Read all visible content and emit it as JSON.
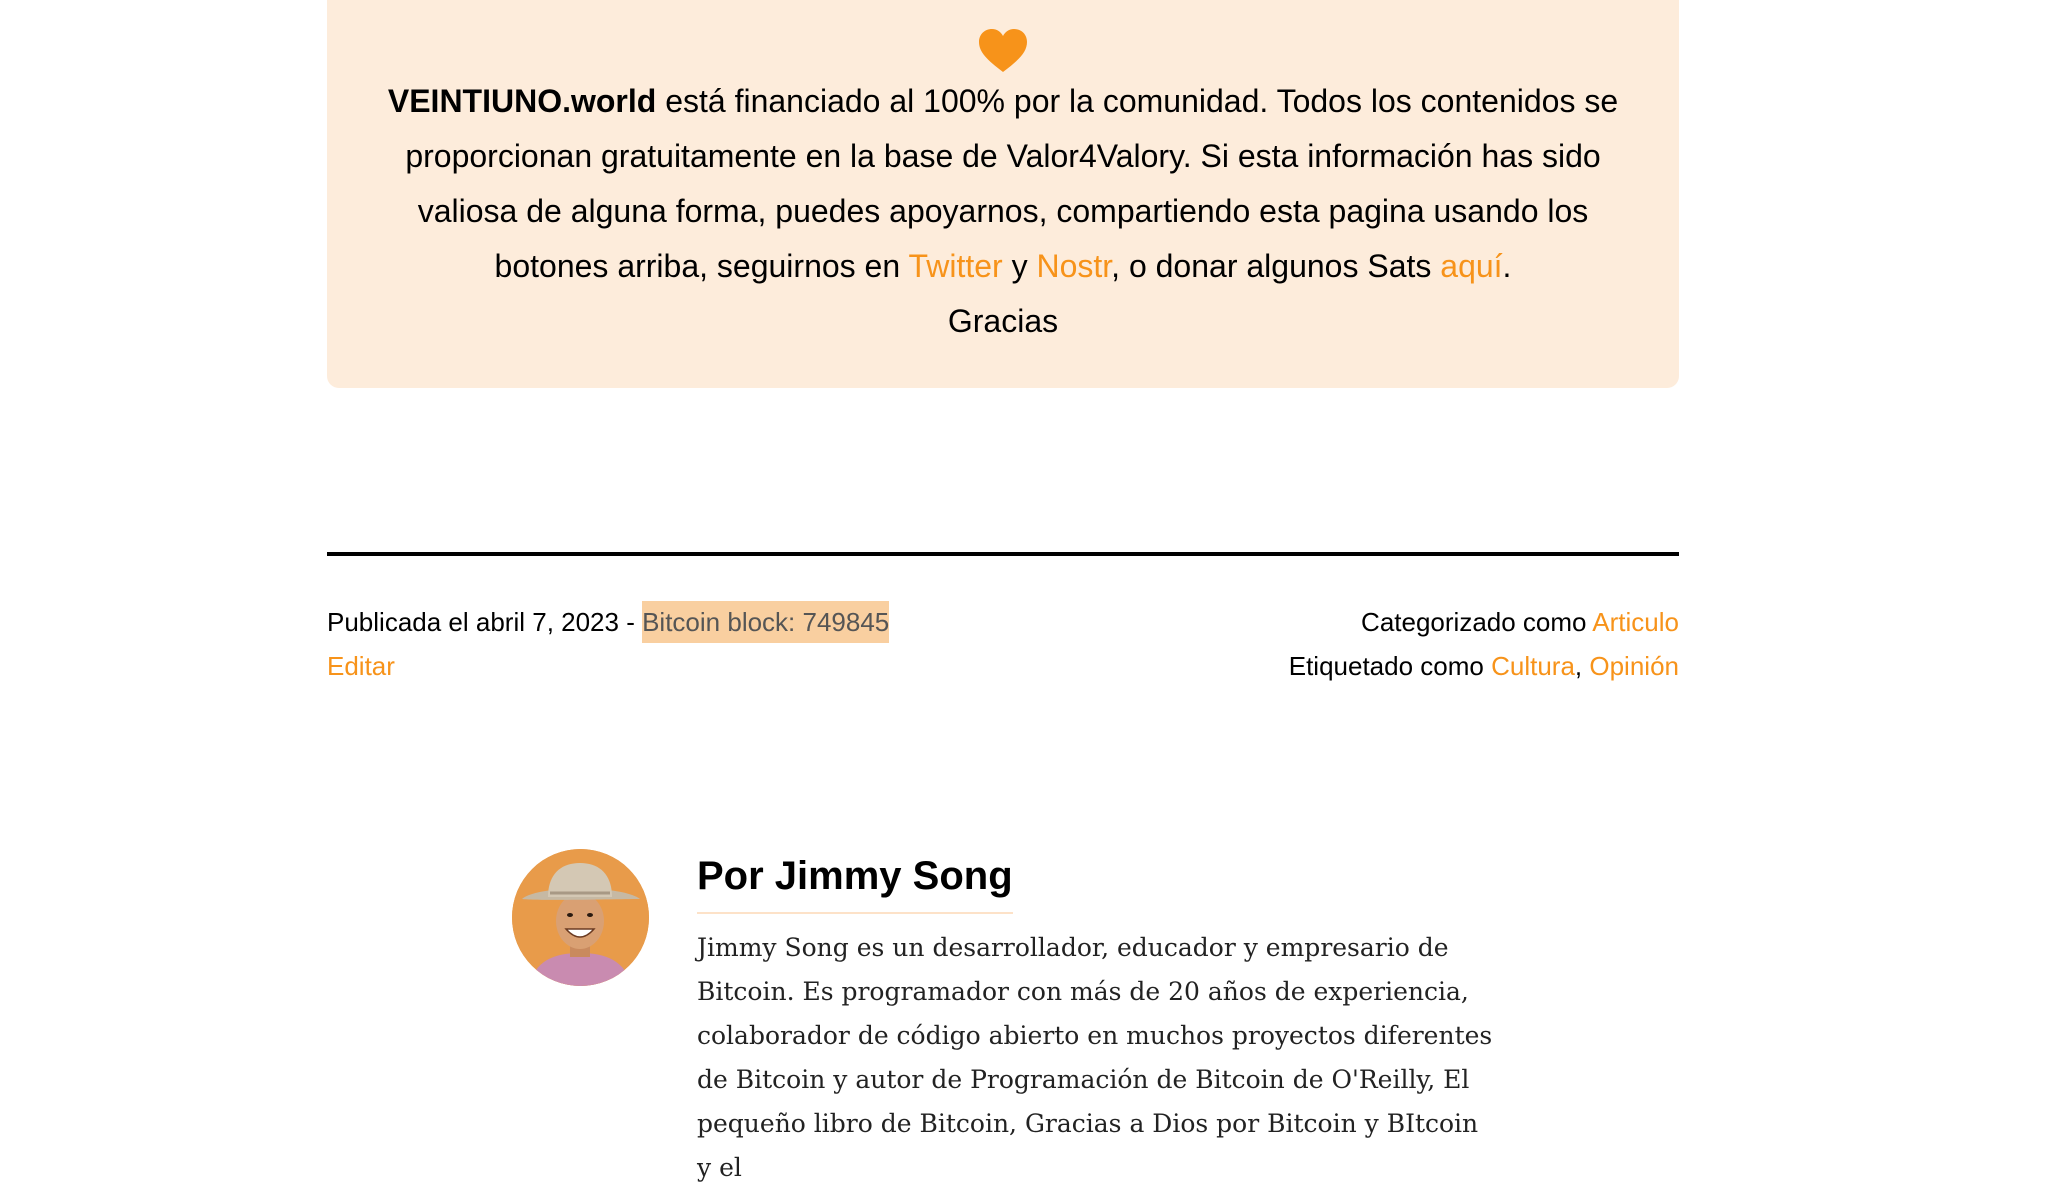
{
  "support": {
    "brand": "VEINTIUNO.world",
    "text_1": " está financiado al 100% por la comunidad. Todos los contenidos se proporcionan gratuitamente en la base de Valor4Valory. Si esta información has sido valiosa de alguna forma, puedes apoyarnos, compartiendo esta pagina usando los botones arriba, seguirnos en ",
    "twitter_label": "Twitter",
    "conj": " y ",
    "nostr_label": "Nostr",
    "text_2": ", o donar algunos Sats ",
    "aqui_label": "aquí",
    "period": ".",
    "thanks": "Gracias",
    "heart_icon": "heart-icon",
    "accent": "#f7931a"
  },
  "meta": {
    "published_prefix": "Publicada el abril 7, 2023 - ",
    "block_label": "Bitcoin block: 749845",
    "edit_label": "Editar",
    "categorized_prefix": "Categorizado como ",
    "category": "Articulo",
    "tagged_prefix": "Etiquetado como ",
    "tag_1": "Cultura",
    "tag_sep": ", ",
    "tag_2": "Opinión"
  },
  "author": {
    "title": "Por Jimmy Song",
    "bio": "Jimmy Song es un desarrollador, educador y empresario de Bitcoin. Es programador con más de 20 años de experiencia, colaborador de código abierto en muchos proyectos diferentes de Bitcoin y autor de Programación de Bitcoin de O'Reilly, El pequeño libro de Bitcoin, Gracias a Dios por Bitcoin y BItcoin y el"
  }
}
